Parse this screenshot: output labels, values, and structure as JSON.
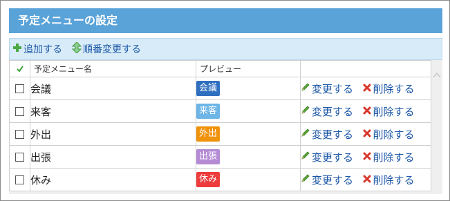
{
  "header": {
    "title": "予定メニューの設定"
  },
  "toolbar": {
    "add_label": "追加する",
    "reorder_label": "順番変更する",
    "add_icon": "plus-icon",
    "reorder_icon": "up-down-arrows-icon"
  },
  "table": {
    "columns": {
      "name": "予定メニュー名",
      "preview": "プレビュー"
    },
    "rows": [
      {
        "name": "会議",
        "badge": "会議",
        "color": "#2f6fc0",
        "edit": "変更する",
        "delete": "削除する"
      },
      {
        "name": "来客",
        "badge": "来客",
        "color": "#6cb5e6",
        "edit": "変更する",
        "delete": "削除する"
      },
      {
        "name": "外出",
        "badge": "外出",
        "color": "#f0930c",
        "edit": "変更する",
        "delete": "削除する"
      },
      {
        "name": "出張",
        "badge": "出張",
        "color": "#b48bd4",
        "edit": "変更する",
        "delete": "削除する"
      },
      {
        "name": "休み",
        "badge": "休み",
        "color": "#ee3b3b",
        "edit": "変更する",
        "delete": "削除する"
      }
    ]
  },
  "colors": {
    "header": "#5aa3d9",
    "toolbar": "#d7ebf8",
    "link": "#1a56a6"
  }
}
